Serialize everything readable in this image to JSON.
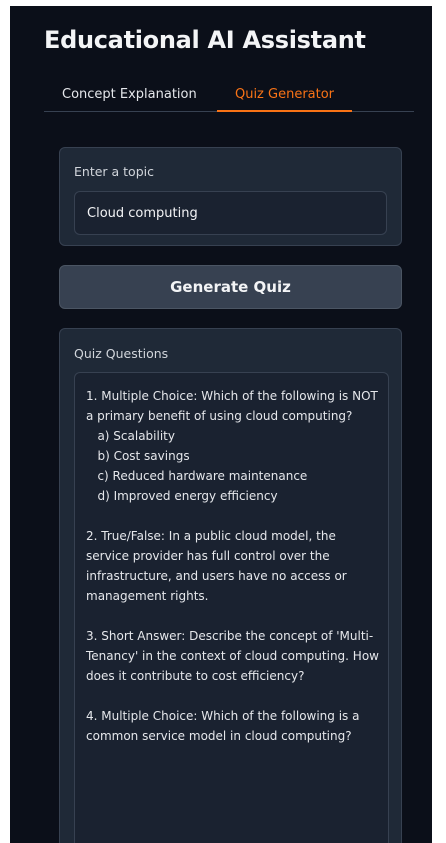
{
  "app": {
    "title": "Educational AI Assistant"
  },
  "tabs": [
    {
      "label": "Concept Explanation",
      "selected": false
    },
    {
      "label": "Quiz Generator",
      "selected": true
    }
  ],
  "topic": {
    "label": "Enter a topic",
    "value": "Cloud computing"
  },
  "generate_button": {
    "label": "Generate Quiz"
  },
  "quiz": {
    "label": "Quiz Questions",
    "text": "1. Multiple Choice: Which of the following is NOT a primary benefit of using cloud computing?\n   a) Scalability\n   b) Cost savings\n   c) Reduced hardware maintenance\n   d) Improved energy efficiency\n\n2. True/False: In a public cloud model, the service provider has full control over the infrastructure, and users have no access or management rights.\n\n3. Short Answer: Describe the concept of 'Multi-Tenancy' in the context of cloud computing. How does it contribute to cost efficiency?\n\n4. Multiple Choice: Which of the following is a common service model in cloud computing?"
  },
  "colors": {
    "background": "#0b0f19",
    "panel": "#1f2937",
    "border": "#374151",
    "accent": "#f97316",
    "button": "#374151"
  }
}
